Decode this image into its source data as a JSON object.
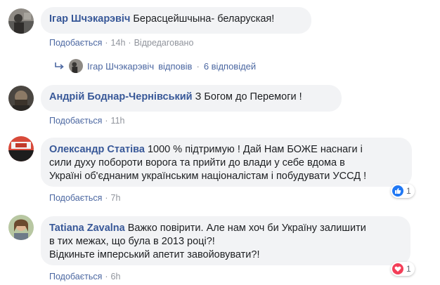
{
  "colors": {
    "link": "#385898",
    "meta": "#90949c",
    "bubble": "#f2f3f5",
    "like_blue": "#2078f4",
    "love_red": "#f33e58"
  },
  "comments": [
    {
      "author": "Ігар Шчэкарэвіч",
      "text": "Берасцейшчына- беларуская!",
      "like_label": "Подобається",
      "time": "14h",
      "edited": "Відредаговано",
      "avatar_icon": "avatar-icon",
      "reply_summary": {
        "author": "Ігар Шчэкарэвіч",
        "replied": "відповів",
        "count": "6 відповідей"
      }
    },
    {
      "author": "Андрій Боднар-Чернівський",
      "text": "З Богом до Перемоги !",
      "like_label": "Подобається",
      "time": "11h",
      "avatar_icon": "avatar-icon"
    },
    {
      "author": "Олександр Статіва",
      "text_lines": [
        "1000 % підтримую ! Дай Нам БОЖЕ наснаги і",
        "сили духу побороти ворога та прийти до влади у себе вдома в",
        "Україні об'єднаним українським націоналістам і побудувати УССД !"
      ],
      "like_label": "Подобається",
      "time": "7h",
      "reaction": {
        "icon": "like-icon",
        "count": "1"
      },
      "avatar_icon": "avatar-icon"
    },
    {
      "author": "Tatiana Zavalna",
      "text_lines": [
        "Важко повірити. Але нам хоч би Україну залишити",
        "в тих межах, що була в 2013 році?!",
        "Відкиньте імперський апетит завойовувати?!"
      ],
      "like_label": "Подобається",
      "time": "6h",
      "reaction": {
        "icon": "love-icon",
        "count": "1"
      },
      "avatar_icon": "avatar-icon"
    }
  ]
}
